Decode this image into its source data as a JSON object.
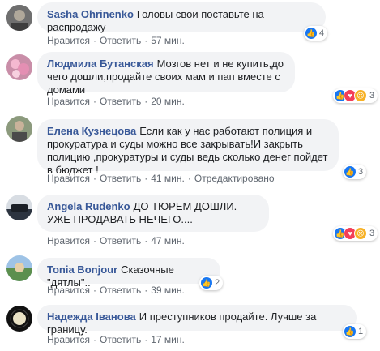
{
  "action_like": "Нравится",
  "action_reply": "Ответить",
  "comments": [
    {
      "author": "Sasha Ohrinenko",
      "text": "Головы свои поставьте на распродажу",
      "time": "57 мин.",
      "reactions": "4",
      "edited": ""
    },
    {
      "author": "Людмила Бутанская",
      "text": "Мозгов нет и не купить,до чего дошли,продайте своих мам и пап вместе с домами",
      "time": "20 мин.",
      "reactions": "3",
      "edited": ""
    },
    {
      "author": "Елена Кузнецова",
      "text": "Если как у нас работают полиция и прокуратура и суды можно все закрывать!И закрыть полицию ,прокуратуры и суды ведь сколько денег пойдет в бюджет !",
      "time": "41 мин.",
      "reactions": "3",
      "edited": "Отредактировано"
    },
    {
      "author": "Angela Rudenko",
      "text": "ДО ТЮРЕМ ДОШЛИ. УЖЕ ПРОДАВАТЬ НЕЧЕГО....",
      "time": "47 мин.",
      "reactions": "3",
      "edited": ""
    },
    {
      "author": "Tonia Bonjour",
      "text": "Сказочные \"дятлы\"..",
      "time": "39 мин.",
      "reactions": "2",
      "edited": ""
    },
    {
      "author": "Надежда Іванова",
      "text": "И преступников продайте. Лучше за границу.",
      "time": "17 мин.",
      "reactions": "1",
      "edited": ""
    }
  ],
  "colors": {
    "author": "#385898",
    "bubble": "#f2f3f5",
    "like": "#1877f2",
    "love": "#f33e58",
    "angry": "#f7b125"
  }
}
